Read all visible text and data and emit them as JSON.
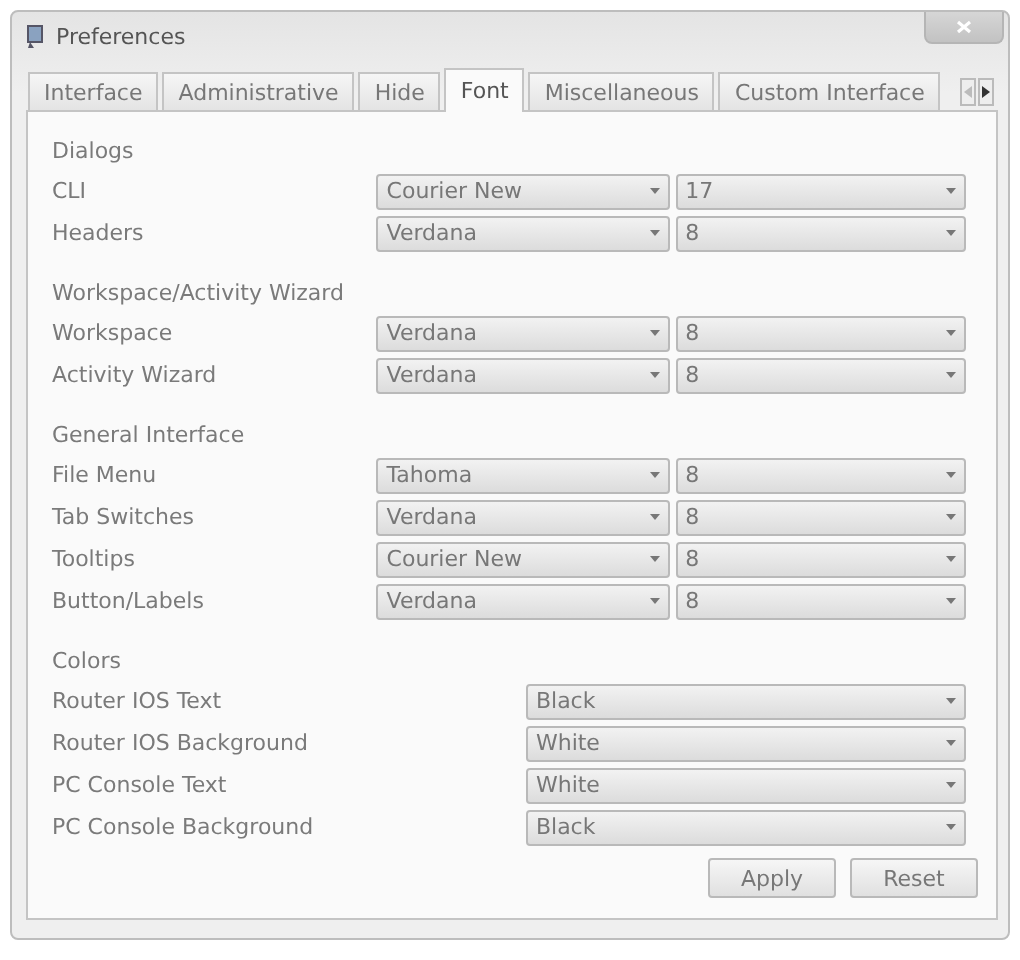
{
  "window": {
    "title": "Preferences"
  },
  "tabs": [
    {
      "label": "Interface",
      "selected": false
    },
    {
      "label": "Administrative",
      "selected": false
    },
    {
      "label": "Hide",
      "selected": false
    },
    {
      "label": "Font",
      "selected": true
    },
    {
      "label": "Miscellaneous",
      "selected": false
    },
    {
      "label": "Custom Interface",
      "selected": false
    }
  ],
  "sections": [
    {
      "heading": "Dialogs",
      "rows": [
        {
          "kind": "font",
          "label": "CLI",
          "font": "Courier New",
          "size": "17"
        },
        {
          "kind": "font",
          "label": "Headers",
          "font": "Verdana",
          "size": "8"
        }
      ]
    },
    {
      "heading": "Workspace/Activity Wizard",
      "rows": [
        {
          "kind": "font",
          "label": "Workspace",
          "font": "Verdana",
          "size": "8"
        },
        {
          "kind": "font",
          "label": "Activity Wizard",
          "font": "Verdana",
          "size": "8"
        }
      ]
    },
    {
      "heading": "General Interface",
      "rows": [
        {
          "kind": "font",
          "label": "File Menu",
          "font": "Tahoma",
          "size": "8"
        },
        {
          "kind": "font",
          "label": "Tab Switches",
          "font": "Verdana",
          "size": "8"
        },
        {
          "kind": "font",
          "label": "Tooltips",
          "font": "Courier New",
          "size": "8"
        },
        {
          "kind": "font",
          "label": "Button/Labels",
          "font": "Verdana",
          "size": "8"
        }
      ]
    },
    {
      "heading": "Colors",
      "rows": [
        {
          "kind": "color",
          "label": "Router IOS Text",
          "value": "Black"
        },
        {
          "kind": "color",
          "label": "Router IOS Background",
          "value": "White"
        },
        {
          "kind": "color",
          "label": "PC Console Text",
          "value": "White"
        },
        {
          "kind": "color",
          "label": "PC Console Background",
          "value": "Black"
        }
      ]
    }
  ],
  "buttons": [
    "Apply",
    "Reset"
  ]
}
